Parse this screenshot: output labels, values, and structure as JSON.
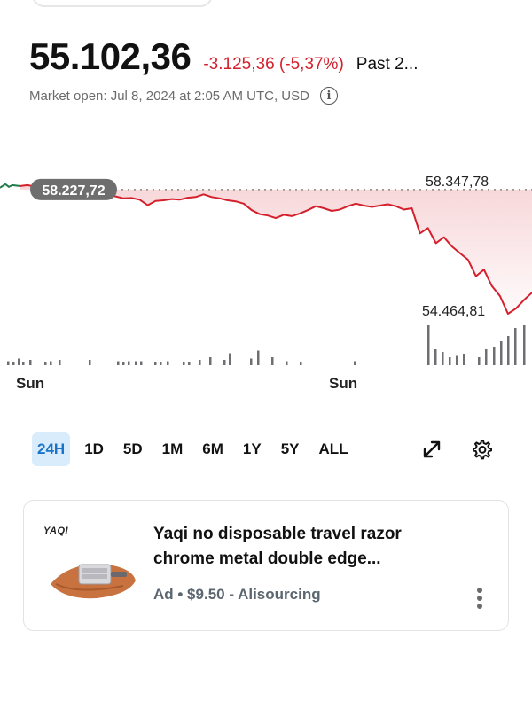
{
  "quote": {
    "price": "55.102,36",
    "change": "-3.125,36 (-5,37%)",
    "period": "Past 2...",
    "market_status": "Market open: Jul 8, 2024 at 2:05 AM UTC, USD",
    "info_icon": "info-icon"
  },
  "colors": {
    "negative": "#d4202c",
    "accent": "#1a73c8",
    "active_bg": "#d9ecfb",
    "prior_line": "#1f7a4a"
  },
  "chart_data": {
    "type": "line",
    "series": [
      {
        "values": [
          58.33,
          58.36,
          58.31,
          58.35,
          58.29,
          58.24,
          58.22,
          58.18,
          58.2,
          58.16,
          58.12,
          58.06,
          58.02,
          57.96,
          57.97,
          57.92,
          57.75,
          57.88,
          57.9,
          57.94,
          57.92,
          57.98,
          58.0,
          58.08,
          58.0,
          57.96,
          57.9,
          57.87,
          57.8,
          57.6,
          57.48,
          57.44,
          57.36,
          57.46,
          57.42,
          57.5,
          57.6,
          57.72,
          57.66,
          57.58,
          57.62,
          57.72,
          57.8,
          57.74,
          57.7,
          57.74,
          57.78,
          57.72,
          57.62,
          57.66,
          56.9,
          57.06,
          56.6,
          56.78,
          56.5,
          56.3,
          56.1,
          55.6,
          55.8,
          55.3,
          55.0,
          54.46,
          54.62,
          54.88,
          55.1
        ]
      }
    ],
    "reference_value": 58.22772,
    "y_ticks": [
      "58.347,78",
      "54.464,81"
    ],
    "price_marker": "58.227,72",
    "x_ticks": [
      "Sun",
      "Sun"
    ],
    "volume": [
      3,
      2,
      5,
      2,
      4,
      2,
      3,
      4,
      4,
      3,
      2,
      3,
      3,
      3,
      2,
      2,
      3,
      2,
      2,
      4,
      6,
      4,
      9,
      5,
      11,
      6,
      3,
      2,
      3,
      30,
      12,
      10,
      6,
      7,
      8,
      6,
      12,
      14,
      18,
      22,
      28,
      30
    ],
    "ylim": [
      54.3,
      58.6
    ],
    "grid": false,
    "legend": "none"
  },
  "time_ranges": [
    "24H",
    "1D",
    "5D",
    "1M",
    "6M",
    "1Y",
    "5Y",
    "ALL"
  ],
  "active_range": "24H",
  "tools": {
    "expand_icon": "expand-icon",
    "settings_icon": "gear-icon"
  },
  "ad": {
    "brand": "YAQI",
    "title": "Yaqi no disposable travel razor chrome metal double edge...",
    "meta": "Ad • $9.50 - Alisourcing",
    "more_icon": "more-vertical-icon",
    "image": "razor-case-image"
  }
}
